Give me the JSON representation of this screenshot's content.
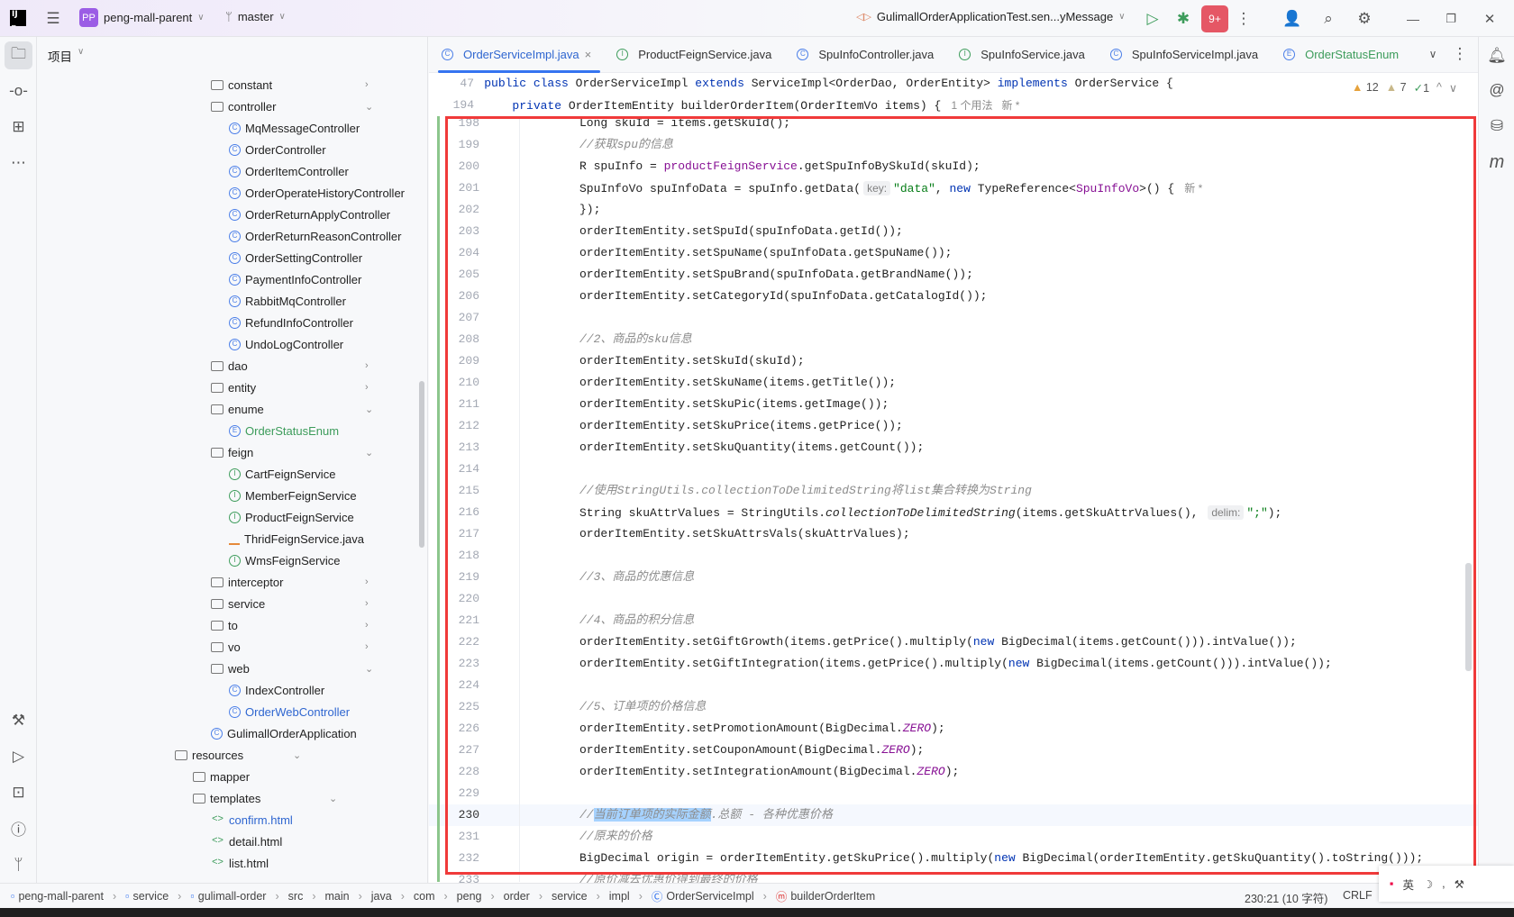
{
  "topbar": {
    "project_initials": "PP",
    "project_name": "peng-mall-parent",
    "branch": "master",
    "run_config": "GulimallOrderApplicationTest.sen...yMessage",
    "update_badge": "9+"
  },
  "project_panel": {
    "title": "项目"
  },
  "tree": [
    {
      "label": "constant",
      "type": "folder",
      "depth": 1,
      "chev": ">"
    },
    {
      "label": "controller",
      "type": "folder",
      "depth": 1,
      "chev": "v"
    },
    {
      "label": "MqMessageController",
      "type": "C",
      "depth": 2
    },
    {
      "label": "OrderController",
      "type": "C",
      "depth": 2
    },
    {
      "label": "OrderItemController",
      "type": "C",
      "depth": 2
    },
    {
      "label": "OrderOperateHistoryController",
      "type": "C",
      "depth": 2
    },
    {
      "label": "OrderReturnApplyController",
      "type": "C",
      "depth": 2
    },
    {
      "label": "OrderReturnReasonController",
      "type": "C",
      "depth": 2
    },
    {
      "label": "OrderSettingController",
      "type": "C",
      "depth": 2
    },
    {
      "label": "PaymentInfoController",
      "type": "C",
      "depth": 2
    },
    {
      "label": "RabbitMqController",
      "type": "C",
      "depth": 2
    },
    {
      "label": "RefundInfoController",
      "type": "C",
      "depth": 2
    },
    {
      "label": "UndoLogController",
      "type": "C",
      "depth": 2
    },
    {
      "label": "dao",
      "type": "folder",
      "depth": 1,
      "chev": ">"
    },
    {
      "label": "entity",
      "type": "folder",
      "depth": 1,
      "chev": ">"
    },
    {
      "label": "enume",
      "type": "folder",
      "depth": 1,
      "chev": "v"
    },
    {
      "label": "OrderStatusEnum",
      "type": "E",
      "depth": 2,
      "color": "#3d9c5b"
    },
    {
      "label": "feign",
      "type": "folder",
      "depth": 1,
      "chev": "v"
    },
    {
      "label": "CartFeignService",
      "type": "I",
      "depth": 2
    },
    {
      "label": "MemberFeignService",
      "type": "I",
      "depth": 2
    },
    {
      "label": "ProductFeignService",
      "type": "I",
      "depth": 2
    },
    {
      "label": "ThridFeignService.java",
      "type": "javaf",
      "depth": 2
    },
    {
      "label": "WmsFeignService",
      "type": "I",
      "depth": 2
    },
    {
      "label": "interceptor",
      "type": "folder",
      "depth": 1,
      "chev": ">"
    },
    {
      "label": "service",
      "type": "folder",
      "depth": 1,
      "chev": ">"
    },
    {
      "label": "to",
      "type": "folder",
      "depth": 1,
      "chev": ">"
    },
    {
      "label": "vo",
      "type": "folder",
      "depth": 1,
      "chev": ">"
    },
    {
      "label": "web",
      "type": "folder",
      "depth": 1,
      "chev": "v"
    },
    {
      "label": "IndexController",
      "type": "C",
      "depth": 2
    },
    {
      "label": "OrderWebController",
      "type": "C",
      "depth": 2,
      "color": "#2f66d0"
    },
    {
      "label": "GulimallOrderApplication",
      "type": "C",
      "depth": 1
    },
    {
      "label": "resources",
      "type": "folder",
      "depth": -1,
      "chev": "v"
    },
    {
      "label": "mapper",
      "type": "folder",
      "depth": 0
    },
    {
      "label": "templates",
      "type": "folder",
      "depth": 0,
      "chev": "v"
    },
    {
      "label": "confirm.html",
      "type": "html",
      "depth": 1,
      "color": "#2f66d0"
    },
    {
      "label": "detail.html",
      "type": "html",
      "depth": 1
    },
    {
      "label": "list.html",
      "type": "html",
      "depth": 1
    }
  ],
  "tabs": [
    {
      "label": "OrderServiceImpl.java",
      "icon": "C",
      "active": true
    },
    {
      "label": "ProductFeignService.java",
      "icon": "I"
    },
    {
      "label": "SpuInfoController.java",
      "icon": "C"
    },
    {
      "label": "SpuInfoService.java",
      "icon": "I"
    },
    {
      "label": "SpuInfoServiceImpl.java",
      "icon": "C"
    },
    {
      "label": "OrderStatusEnum",
      "icon": "E"
    }
  ],
  "inspections": {
    "warnings": "12",
    "weak_warnings": "7",
    "ok": "1"
  },
  "sticky": [
    {
      "n": "47",
      "tokens": [
        [
          "",
          "    "
        ],
        [
          "kw",
          "public class "
        ],
        [
          "",
          "OrderServiceImpl "
        ],
        [
          "kw",
          "extends "
        ],
        [
          "",
          "ServiceImpl<OrderDao, OrderEntity> "
        ],
        [
          "kw",
          "implements "
        ],
        [
          "",
          "OrderService {"
        ]
      ]
    },
    {
      "n": "194",
      "tokens": [
        [
          "",
          "        "
        ],
        [
          "kw",
          "private "
        ],
        [
          "",
          "OrderItemEntity builderOrderItem(OrderItemVo items) { "
        ],
        [
          "gray",
          " 1 个用法   新 *"
        ]
      ]
    }
  ],
  "code": [
    {
      "n": "198",
      "tokens": [
        [
          "",
          "Long skuId = items.getSkuId();"
        ]
      ]
    },
    {
      "n": "199",
      "tokens": [
        [
          "cm",
          "//获取spu的信息"
        ]
      ]
    },
    {
      "n": "200",
      "tokens": [
        [
          "",
          "R spuInfo = "
        ],
        [
          "fld",
          "productFeignService"
        ],
        [
          "",
          ".getSpuInfoBySkuId(skuId);"
        ]
      ]
    },
    {
      "n": "201",
      "tokens": [
        [
          "",
          "SpuInfoVo spuInfoData = spuInfo.getData("
        ],
        [
          "hint",
          "key:"
        ],
        [
          "str",
          "\"data\""
        ],
        [
          "",
          ", "
        ],
        [
          "kw",
          "new "
        ],
        [
          "",
          "TypeReference<"
        ],
        [
          "fld",
          "SpuInfoVo"
        ],
        [
          "",
          ">() { "
        ],
        [
          "gray",
          " 新 *"
        ]
      ]
    },
    {
      "n": "202",
      "tokens": [
        [
          "",
          "});"
        ]
      ]
    },
    {
      "n": "203",
      "tokens": [
        [
          "",
          "orderItemEntity.setSpuId(spuInfoData.getId());"
        ]
      ]
    },
    {
      "n": "204",
      "tokens": [
        [
          "",
          "orderItemEntity.setSpuName(spuInfoData.getSpuName());"
        ]
      ]
    },
    {
      "n": "205",
      "tokens": [
        [
          "",
          "orderItemEntity.setSpuBrand(spuInfoData.getBrandName());"
        ]
      ]
    },
    {
      "n": "206",
      "tokens": [
        [
          "",
          "orderItemEntity.setCategoryId(spuInfoData.getCatalogId());"
        ]
      ]
    },
    {
      "n": "207",
      "tokens": []
    },
    {
      "n": "208",
      "tokens": [
        [
          "cm",
          "//2、商品的sku信息"
        ]
      ]
    },
    {
      "n": "209",
      "tokens": [
        [
          "",
          "orderItemEntity.setSkuId(skuId);"
        ]
      ]
    },
    {
      "n": "210",
      "tokens": [
        [
          "",
          "orderItemEntity.setSkuName(items.getTitle());"
        ]
      ]
    },
    {
      "n": "211",
      "tokens": [
        [
          "",
          "orderItemEntity.setSkuPic(items.getImage());"
        ]
      ]
    },
    {
      "n": "212",
      "tokens": [
        [
          "",
          "orderItemEntity.setSkuPrice(items.getPrice());"
        ]
      ]
    },
    {
      "n": "213",
      "tokens": [
        [
          "",
          "orderItemEntity.setSkuQuantity(items.getCount());"
        ]
      ]
    },
    {
      "n": "214",
      "tokens": []
    },
    {
      "n": "215",
      "tokens": [
        [
          "cm",
          "//使用StringUtils.collectionToDelimitedString将list集合转换为String"
        ]
      ]
    },
    {
      "n": "216",
      "tokens": [
        [
          "",
          "String skuAttrValues = StringUtils."
        ],
        [
          "it",
          "collectionToDelimitedString"
        ],
        [
          "",
          "(items.getSkuAttrValues(), "
        ],
        [
          "hint",
          "delim:"
        ],
        [
          "str",
          "\";\""
        ],
        [
          "",
          ");"
        ]
      ]
    },
    {
      "n": "217",
      "tokens": [
        [
          "",
          "orderItemEntity.setSkuAttrsVals(skuAttrValues);"
        ]
      ]
    },
    {
      "n": "218",
      "tokens": []
    },
    {
      "n": "219",
      "tokens": [
        [
          "cm",
          "//3、商品的优惠信息"
        ]
      ]
    },
    {
      "n": "220",
      "tokens": []
    },
    {
      "n": "221",
      "tokens": [
        [
          "cm",
          "//4、商品的积分信息"
        ]
      ]
    },
    {
      "n": "222",
      "tokens": [
        [
          "",
          "orderItemEntity.setGiftGrowth(items.getPrice().multiply("
        ],
        [
          "kw",
          "new "
        ],
        [
          "",
          "BigDecimal(items.getCount())).intValue());"
        ]
      ]
    },
    {
      "n": "223",
      "tokens": [
        [
          "",
          "orderItemEntity.setGiftIntegration(items.getPrice().multiply("
        ],
        [
          "kw",
          "new "
        ],
        [
          "",
          "BigDecimal(items.getCount())).intValue());"
        ]
      ]
    },
    {
      "n": "224",
      "tokens": []
    },
    {
      "n": "225",
      "tokens": [
        [
          "cm",
          "//5、订单项的价格信息"
        ]
      ]
    },
    {
      "n": "226",
      "tokens": [
        [
          "",
          "orderItemEntity.setPromotionAmount(BigDecimal."
        ],
        [
          "cst",
          "ZERO"
        ],
        [
          "",
          ");"
        ]
      ]
    },
    {
      "n": "227",
      "tokens": [
        [
          "",
          "orderItemEntity.setCouponAmount(BigDecimal."
        ],
        [
          "cst",
          "ZERO"
        ],
        [
          "",
          ");"
        ]
      ]
    },
    {
      "n": "228",
      "tokens": [
        [
          "",
          "orderItemEntity.setIntegrationAmount(BigDecimal."
        ],
        [
          "cst",
          "ZERO"
        ],
        [
          "",
          ");"
        ]
      ]
    },
    {
      "n": "229",
      "tokens": []
    },
    {
      "n": "230",
      "current": true,
      "tokens": [
        [
          "cm",
          "//"
        ],
        [
          "cm sel",
          "当前订单项的实际金额"
        ],
        [
          "cm",
          ".总额 - 各种优惠价格"
        ]
      ]
    },
    {
      "n": "231",
      "tokens": [
        [
          "cm",
          "//原来的价格"
        ]
      ]
    },
    {
      "n": "232",
      "tokens": [
        [
          "",
          "BigDecimal origin = orderItemEntity.getSkuPrice().multiply("
        ],
        [
          "kw",
          "new "
        ],
        [
          "",
          "BigDecimal(orderItemEntity.getSkuQuantity().toString()));"
        ]
      ]
    },
    {
      "n": "233",
      "tokens": [
        [
          "cm",
          "//原价减去优惠价得到最终的价格"
        ]
      ]
    }
  ],
  "statusbar": {
    "breadcrumbs": [
      {
        "label": "peng-mall-parent",
        "icon": "module"
      },
      {
        "label": "service",
        "icon": "module"
      },
      {
        "label": "gulimall-order",
        "icon": "module"
      },
      {
        "label": "src"
      },
      {
        "label": "main"
      },
      {
        "label": "java"
      },
      {
        "label": "com"
      },
      {
        "label": "peng"
      },
      {
        "label": "order"
      },
      {
        "label": "service"
      },
      {
        "label": "impl"
      },
      {
        "label": "OrderServiceImpl",
        "icon": "class"
      },
      {
        "label": "builderOrderItem",
        "icon": "method"
      }
    ],
    "position": "230:21 (10 字符)",
    "line_ending": "CRLF",
    "ime": "英"
  },
  "colors": {
    "accent": "#3574f0",
    "highlight_box": "#f03a3a",
    "selection": "#a6d2ff"
  }
}
